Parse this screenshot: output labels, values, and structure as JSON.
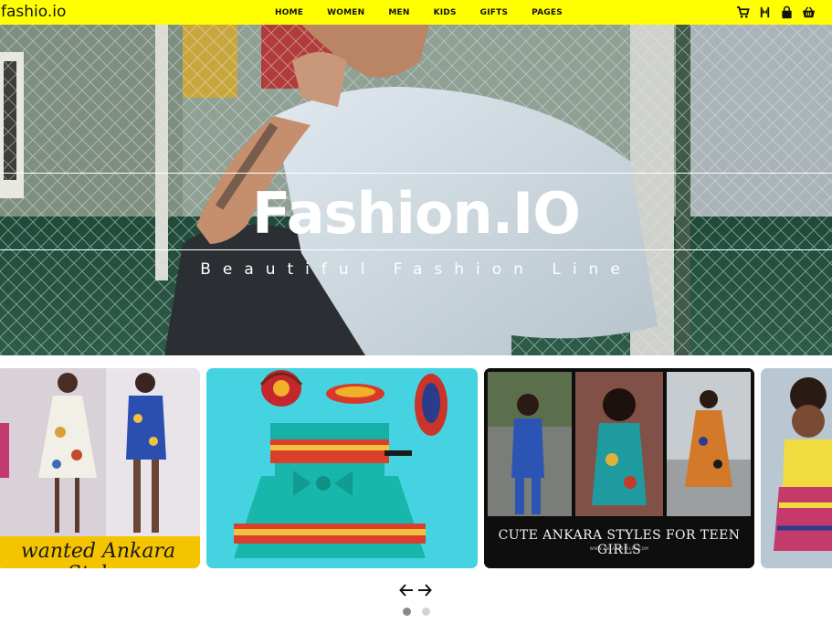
{
  "brand": {
    "name": "fashio.io"
  },
  "nav": {
    "links": [
      {
        "label": "HOME"
      },
      {
        "label": "WOMEN"
      },
      {
        "label": "MEN"
      },
      {
        "label": "KIDS"
      },
      {
        "label": "GIFTS"
      },
      {
        "label": "PAGES"
      }
    ],
    "icons": [
      "cart-icon",
      "bookmark-icon",
      "bag-icon",
      "basket-icon"
    ]
  },
  "hero": {
    "title": "Fashion.IO",
    "subtitle": "Beautiful Fashion Line"
  },
  "carousel": {
    "cards": [
      {
        "caption": "wanted Ankara Styles"
      },
      {
        "caption": ""
      },
      {
        "caption": "CUTE ANKARA STYLES FOR TEEN GIRLS",
        "subcaption": "WWW.ANKARASTYLES.COM"
      },
      {
        "caption": ""
      }
    ],
    "prev_label": "←",
    "next_label": "→",
    "active_index": 0,
    "dot_count": 2
  },
  "colors": {
    "navbar": "#ffff00",
    "caption_band": "#f5c400",
    "teal_bg": "#45d3e2",
    "dot_active": "#8a8a8a",
    "dot_inactive": "#d4d4d4"
  }
}
